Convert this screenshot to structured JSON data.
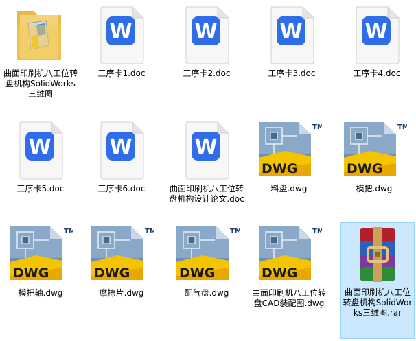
{
  "files": [
    {
      "name": "曲面印刷机八工位转盘机构SolidWorks三维图",
      "type": "folder"
    },
    {
      "name": "工序卡1.doc",
      "type": "doc"
    },
    {
      "name": "工序卡2.doc",
      "type": "doc"
    },
    {
      "name": "工序卡3.doc",
      "type": "doc"
    },
    {
      "name": "工序卡4.doc",
      "type": "doc"
    },
    {
      "name": "工序卡5.doc",
      "type": "doc"
    },
    {
      "name": "工序卡6.doc",
      "type": "doc"
    },
    {
      "name": "曲面印刷机八工位转盘机构设计论文.doc",
      "type": "doc"
    },
    {
      "name": "料盘.dwg",
      "type": "dwg"
    },
    {
      "name": "模把.dwg",
      "type": "dwg"
    },
    {
      "name": "模把轴.dwg",
      "type": "dwg"
    },
    {
      "name": "摩擦片.dwg",
      "type": "dwg"
    },
    {
      "name": "配气盘.dwg",
      "type": "dwg"
    },
    {
      "name": "曲面印刷机八工位转盘CAD装配图.dwg",
      "type": "dwg"
    },
    {
      "name": "曲面印刷机八工位转盘机构SolidWorks三维图.rar",
      "type": "rar"
    }
  ],
  "dwg_label": "DWG",
  "tm_label": "TM",
  "doc_letter": "W"
}
